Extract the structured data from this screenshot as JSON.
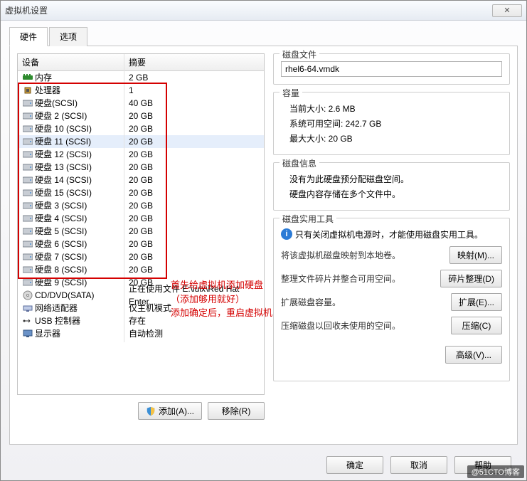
{
  "window": {
    "title": "虚拟机设置",
    "close": "✕"
  },
  "tabs": [
    "硬件",
    "选项"
  ],
  "list": {
    "headers": [
      "设备",
      "摘要"
    ],
    "rows": [
      {
        "icon": "mem",
        "name": "内存",
        "summary": "2 GB"
      },
      {
        "icon": "cpu",
        "name": "处理器",
        "summary": "1"
      },
      {
        "icon": "hdd",
        "name": "硬盘(SCSI)",
        "summary": "40 GB"
      },
      {
        "icon": "hdd",
        "name": "硬盘 2 (SCSI)",
        "summary": "20 GB"
      },
      {
        "icon": "hdd",
        "name": "硬盘 10 (SCSI)",
        "summary": "20 GB"
      },
      {
        "icon": "hdd",
        "name": "硬盘 11 (SCSI)",
        "summary": "20 GB",
        "selected": true
      },
      {
        "icon": "hdd",
        "name": "硬盘 12 (SCSI)",
        "summary": "20 GB"
      },
      {
        "icon": "hdd",
        "name": "硬盘 13 (SCSI)",
        "summary": "20 GB"
      },
      {
        "icon": "hdd",
        "name": "硬盘 14 (SCSI)",
        "summary": "20 GB"
      },
      {
        "icon": "hdd",
        "name": "硬盘 15 (SCSI)",
        "summary": "20 GB"
      },
      {
        "icon": "hdd",
        "name": "硬盘 3 (SCSI)",
        "summary": "20 GB"
      },
      {
        "icon": "hdd",
        "name": "硬盘 4 (SCSI)",
        "summary": "20 GB"
      },
      {
        "icon": "hdd",
        "name": "硬盘 5 (SCSI)",
        "summary": "20 GB"
      },
      {
        "icon": "hdd",
        "name": "硬盘 6 (SCSI)",
        "summary": "20 GB"
      },
      {
        "icon": "hdd",
        "name": "硬盘 7 (SCSI)",
        "summary": "20 GB"
      },
      {
        "icon": "hdd",
        "name": "硬盘 8 (SCSI)",
        "summary": "20 GB"
      },
      {
        "icon": "hdd",
        "name": "硬盘 9 (SCSI)",
        "summary": "20 GB"
      },
      {
        "icon": "cd",
        "name": "CD/DVD(SATA)",
        "summary": "正在使用文件 E:\\luix\\Red Hat Enter..."
      },
      {
        "icon": "net",
        "name": "网络适配器",
        "summary": "仅主机模式"
      },
      {
        "icon": "usb",
        "name": "USB 控制器",
        "summary": "存在"
      },
      {
        "icon": "disp",
        "name": "显示器",
        "summary": "自动检测"
      }
    ]
  },
  "annotation": {
    "line1": "首先给虚拟机添加硬盘",
    "line2": "（添加够用就好）",
    "line3": "添加确定后，重启虚拟机"
  },
  "leftButtons": {
    "add": "添加(A)...",
    "remove": "移除(R)"
  },
  "right": {
    "diskFile": {
      "title": "磁盘文件",
      "value": "rhel6-64.vmdk"
    },
    "capacity": {
      "title": "容量",
      "current": "当前大小: 2.6 MB",
      "sysFree": "系统可用空间: 242.7 GB",
      "max": "最大大小: 20 GB"
    },
    "diskInfo": {
      "title": "磁盘信息",
      "line1": "没有为此硬盘预分配磁盘空间。",
      "line2": "硬盘内容存储在多个文件中。"
    },
    "utils": {
      "title": "磁盘实用工具",
      "hint": "只有关闭虚拟机电源时，才能使用磁盘实用工具。",
      "map": {
        "label": "将该虚拟机磁盘映射到本地卷。",
        "btn": "映射(M)..."
      },
      "defrag": {
        "label": "整理文件碎片并整合可用空间。",
        "btn": "碎片整理(D)"
      },
      "expand": {
        "label": "扩展磁盘容量。",
        "btn": "扩展(E)..."
      },
      "compact": {
        "label": "压缩磁盘以回收未使用的空间。",
        "btn": "压缩(C)"
      },
      "advanced": "高级(V)..."
    }
  },
  "bottomButtons": {
    "ok": "确定",
    "cancel": "取消",
    "help": "帮助"
  },
  "watermark": "@51CTO博客"
}
